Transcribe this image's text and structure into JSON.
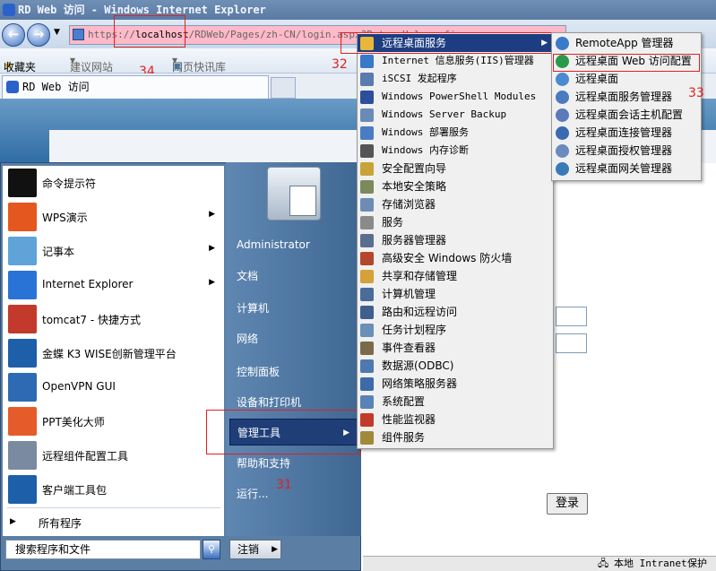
{
  "window_title": "RD Web 访问 - Windows Internet Explorer",
  "address": {
    "prefix": "https://",
    "host": "localhost",
    "path": "/RDWeb/Pages/zh-CN/login.aspx?ReturnUrl=config.aspx"
  },
  "favorites_bar": {
    "favorites": "收藏夹",
    "suggested_sites": "建议网站",
    "web_slice": "网页快讯库"
  },
  "tab": {
    "title": "RD Web 访问"
  },
  "annotations": {
    "a31": "31",
    "a32": "32",
    "a33": "33",
    "a34": "34"
  },
  "page": {
    "login_button": "登录"
  },
  "status_bar": {
    "zone": "本地 Intranet",
    "mode": "保护"
  },
  "start_menu": {
    "programs": [
      {
        "label": "命令提示符",
        "icon": "cmd-icon",
        "color": "#111111",
        "submenu": false
      },
      {
        "label": "WPS演示",
        "icon": "wps-icon",
        "color": "#e4571f",
        "submenu": true
      },
      {
        "label": "记事本",
        "icon": "notepad-icon",
        "color": "#5fa3d8",
        "submenu": true
      },
      {
        "label": "Internet Explorer",
        "icon": "ie-icon",
        "color": "#2a73d6",
        "submenu": true
      },
      {
        "label": "tomcat7 - 快捷方式",
        "icon": "tomcat-icon",
        "color": "#c33a2c",
        "submenu": false
      },
      {
        "label": "金蝶 K3 WISE创新管理平台",
        "icon": "kingdee-icon",
        "color": "#1d5fa8",
        "submenu": false
      },
      {
        "label": "OpenVPN GUI",
        "icon": "openvpn-icon",
        "color": "#2e6ab3",
        "submenu": false
      },
      {
        "label": "PPT美化大师",
        "icon": "ppt-icon",
        "color": "#e65b2a",
        "submenu": false
      },
      {
        "label": "远程组件配置工具",
        "icon": "gear-icon",
        "color": "#7a8aa0",
        "submenu": false
      },
      {
        "label": "客户端工具包",
        "icon": "kingdee-icon",
        "color": "#1d5fa8",
        "submenu": false
      }
    ],
    "all_programs": "所有程序",
    "search_placeholder": "搜索程序和文件",
    "right_items": [
      "Administrator",
      "文档",
      "计算机",
      "网络",
      "控制面板",
      "设备和打印机",
      "管理工具",
      "帮助和支持",
      "运行..."
    ],
    "logout": "注销"
  },
  "admin_tools": [
    {
      "label": "远程桌面服务",
      "icon": "folder-icon",
      "color": "#e8b73a",
      "submenu": true
    },
    {
      "label": "Internet 信息服务(IIS)管理器",
      "icon": "iis-icon",
      "color": "#3a78c8"
    },
    {
      "label": "iSCSI 发起程序",
      "icon": "iscsi-icon",
      "color": "#5a7ab0"
    },
    {
      "label": "Windows PowerShell Modules",
      "icon": "powershell-icon",
      "color": "#2b4f9a"
    },
    {
      "label": "Windows Server Backup",
      "icon": "backup-icon",
      "color": "#6b8bb7"
    },
    {
      "label": "Windows 部署服务",
      "icon": "deploy-icon",
      "color": "#4a7cc3"
    },
    {
      "label": "Windows 内存诊断",
      "icon": "memory-icon",
      "color": "#555555"
    },
    {
      "label": "安全配置向导",
      "icon": "security-icon",
      "color": "#c9a33a"
    },
    {
      "label": "本地安全策略",
      "icon": "policy-icon",
      "color": "#7a8a5a"
    },
    {
      "label": "存储浏览器",
      "icon": "storage-icon",
      "color": "#6d8cb4"
    },
    {
      "label": "服务",
      "icon": "services-icon",
      "color": "#8a8a8a"
    },
    {
      "label": "服务器管理器",
      "icon": "server-manager-icon",
      "color": "#5a6f8f"
    },
    {
      "label": "高级安全 Windows 防火墙",
      "icon": "firewall-icon",
      "color": "#b5462e"
    },
    {
      "label": "共享和存储管理",
      "icon": "share-icon",
      "color": "#d4a13a"
    },
    {
      "label": "计算机管理",
      "icon": "computer-mgmt-icon",
      "color": "#4b6b98"
    },
    {
      "label": "路由和远程访问",
      "icon": "routing-icon",
      "color": "#3f5f8f"
    },
    {
      "label": "任务计划程序",
      "icon": "scheduler-icon",
      "color": "#6a8fb8"
    },
    {
      "label": "事件查看器",
      "icon": "event-viewer-icon",
      "color": "#7a6a4a"
    },
    {
      "label": "数据源(ODBC)",
      "icon": "odbc-icon",
      "color": "#4f78b0"
    },
    {
      "label": "网络策略服务器",
      "icon": "nps-icon",
      "color": "#3d6aa8"
    },
    {
      "label": "系统配置",
      "icon": "msconfig-icon",
      "color": "#5a82b8"
    },
    {
      "label": "性能监视器",
      "icon": "perfmon-icon",
      "color": "#c23a2a"
    },
    {
      "label": "组件服务",
      "icon": "component-icon",
      "color": "#a08a3a"
    }
  ],
  "rds_submenu": [
    {
      "label": "RemoteApp 管理器",
      "icon": "remoteapp-icon",
      "color": "#3a7ac8"
    },
    {
      "label": "远程桌面 Web 访问配置",
      "icon": "web-access-icon",
      "color": "#2a9a4a"
    },
    {
      "label": "远程桌面",
      "icon": "remote-desktop-icon",
      "color": "#4a8ad0"
    },
    {
      "label": "远程桌面服务管理器",
      "icon": "rds-manager-icon",
      "color": "#4a7ac0"
    },
    {
      "label": "远程桌面会话主机配置",
      "icon": "session-host-icon",
      "color": "#5a7ab8"
    },
    {
      "label": "远程桌面连接管理器",
      "icon": "connection-broker-icon",
      "color": "#3a6ab0"
    },
    {
      "label": "远程桌面授权管理器",
      "icon": "licensing-icon",
      "color": "#6a8ac0"
    },
    {
      "label": "远程桌面网关管理器",
      "icon": "gateway-icon",
      "color": "#3a7ab8"
    }
  ]
}
